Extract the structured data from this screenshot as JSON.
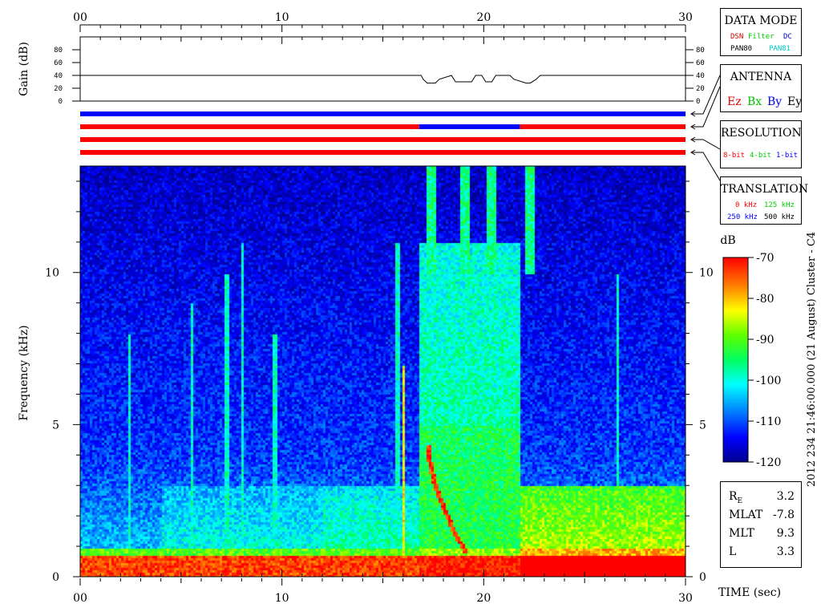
{
  "time_axis": {
    "ticks": [
      "00",
      "10",
      "20",
      "30"
    ],
    "label": "TIME (sec)"
  },
  "gain": {
    "label": "Gain (dB)",
    "ticks": [
      "80",
      "60",
      "40",
      "20",
      "0"
    ]
  },
  "frequency_axis": {
    "label": "Frequency (kHz)",
    "ticks": [
      "10",
      "5",
      "0"
    ]
  },
  "colorbar": {
    "unit": "dB",
    "ticks": [
      "-70",
      "-80",
      "-90",
      "-100",
      "-110",
      "-120"
    ]
  },
  "caption": "2012 234 21:46:00.000 (21 August)  Cluster - C4",
  "data_mode": {
    "title": "DATA MODE",
    "items": [
      "DSN",
      "Filter",
      "DC",
      "PAN80",
      "PAN81"
    ],
    "colors": [
      "#cc0000",
      "#00cc00",
      "#0000cc",
      "#000000",
      "#00cccc"
    ]
  },
  "antenna": {
    "title": "ANTENNA",
    "items": [
      "Ez",
      "Bx",
      "By",
      "Ey"
    ],
    "colors": [
      "#e00000",
      "#00c000",
      "#0000e0",
      "#000000"
    ]
  },
  "resolution": {
    "title": "RESOLUTION",
    "items": [
      "8-bit",
      "4-bit",
      "1-bit"
    ],
    "colors": [
      "#ff0000",
      "#00cc00",
      "#0000ff"
    ]
  },
  "translation": {
    "title": "TRANSLATION",
    "items": [
      "0 kHz",
      "125 kHz",
      "250 kHz",
      "500 kHz"
    ],
    "colors": [
      "#ff0000",
      "#00cc00",
      "#0000ff",
      "#000000"
    ]
  },
  "ephemeris": [
    {
      "label": "RE",
      "value": "3.2"
    },
    {
      "label": "MLAT",
      "value": "-7.8"
    },
    {
      "label": "MLT",
      "value": "9.3"
    },
    {
      "label": "L",
      "value": "3.3"
    }
  ],
  "chart_data": {
    "type": "heatmap",
    "title": "",
    "xlabel": "TIME (sec)",
    "ylabel": "Frequency (kHz)",
    "xlim": [
      0,
      30
    ],
    "ylim": [
      0,
      13.5
    ],
    "zlabel": "dB",
    "zlim": [
      -120,
      -70
    ],
    "gain_trace": {
      "t": [
        0,
        16.9,
        17.0,
        17.2,
        17.6,
        17.8,
        18.4,
        18.6,
        19.4,
        19.6,
        19.9,
        20.1,
        20.4,
        20.6,
        21.3,
        21.5,
        22.1,
        22.3,
        22.6,
        22.8,
        30
      ],
      "db": [
        40,
        40,
        34,
        28,
        28,
        34,
        40,
        30,
        30,
        40,
        40,
        30,
        30,
        40,
        40,
        34,
        28,
        28,
        34,
        40,
        40
      ]
    },
    "mode_bars": [
      {
        "name": "DATA MODE",
        "segments": [
          {
            "t0": 0,
            "t1": 30,
            "color": "#0000ff"
          }
        ]
      },
      {
        "name": "ANTENNA",
        "segments": [
          {
            "t0": 0,
            "t1": 16.8,
            "color": "#ff0000"
          },
          {
            "t0": 16.8,
            "t1": 21.8,
            "color": "#0000ff"
          },
          {
            "t0": 21.8,
            "t1": 30,
            "color": "#ff0000"
          }
        ]
      },
      {
        "name": "RESOLUTION",
        "segments": [
          {
            "t0": 0,
            "t1": 30,
            "color": "#ff0000"
          }
        ]
      },
      {
        "name": "TRANSLATION",
        "segments": [
          {
            "t0": 0,
            "t1": 30,
            "color": "#ff0000"
          }
        ]
      }
    ]
  }
}
